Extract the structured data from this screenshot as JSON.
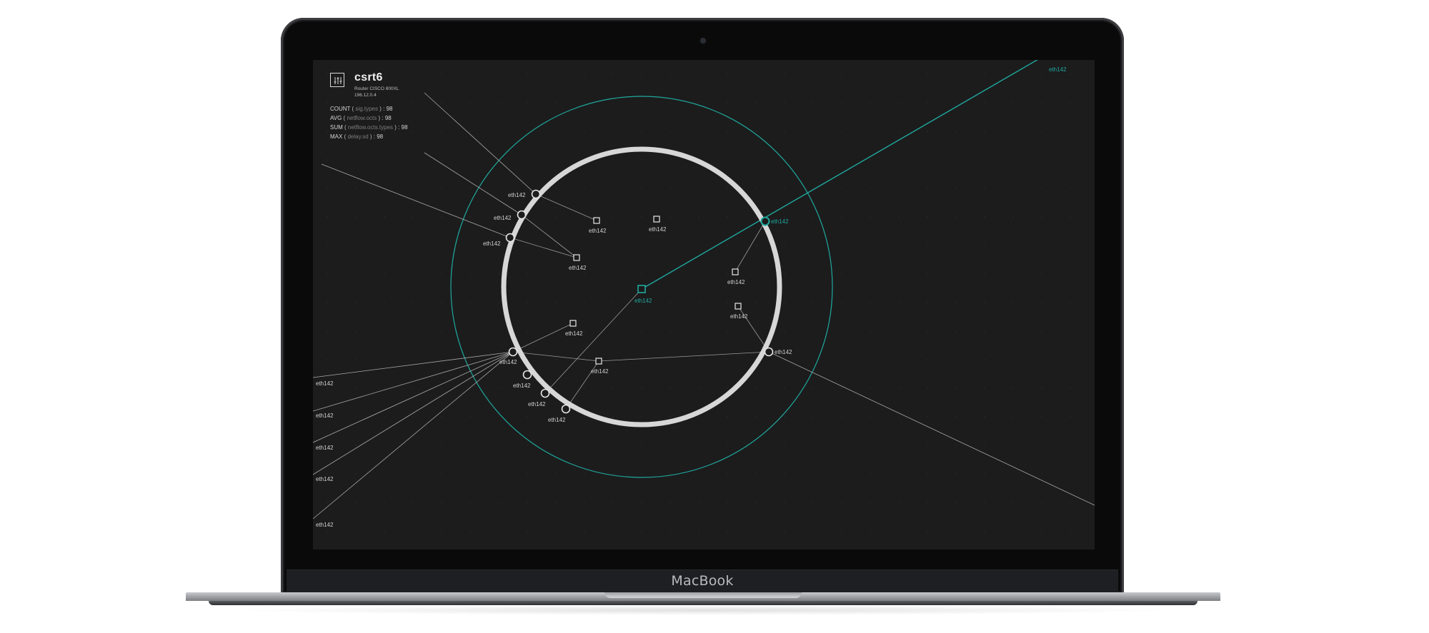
{
  "device": {
    "name": "csrt6",
    "model": "Router CISCO 800XL",
    "ip": "196.12.0.4"
  },
  "metrics": [
    {
      "func": "COUNT",
      "field": "sig.types",
      "value": "98"
    },
    {
      "func": "AVG",
      "field": "netflow.octs",
      "value": "98"
    },
    {
      "func": "SUM",
      "field": "netflow.octs.types",
      "value": "98"
    },
    {
      "func": "MAX",
      "field": "delay.sd",
      "value": "98"
    }
  ],
  "laptop": {
    "brand": "MacBook"
  },
  "colors": {
    "accent": "#1fa89c",
    "background": "#1c1c1d",
    "line": "#a9a9a9",
    "ring": "#d7d7d7"
  },
  "labels": {
    "top_right": "eth142",
    "center_node": "eth142",
    "accent_port": "eth142",
    "left_edge": [
      "eth142",
      "eth142",
      "eth142",
      "eth142",
      "eth142"
    ],
    "ports": [
      "eth142",
      "eth142",
      "eth142",
      "eth142",
      "eth142",
      "eth142",
      "eth142",
      "eth142"
    ],
    "inner_nodes": [
      "eth142",
      "eth142",
      "eth142",
      "eth142",
      "eth142",
      "eth142",
      "eth142"
    ]
  }
}
